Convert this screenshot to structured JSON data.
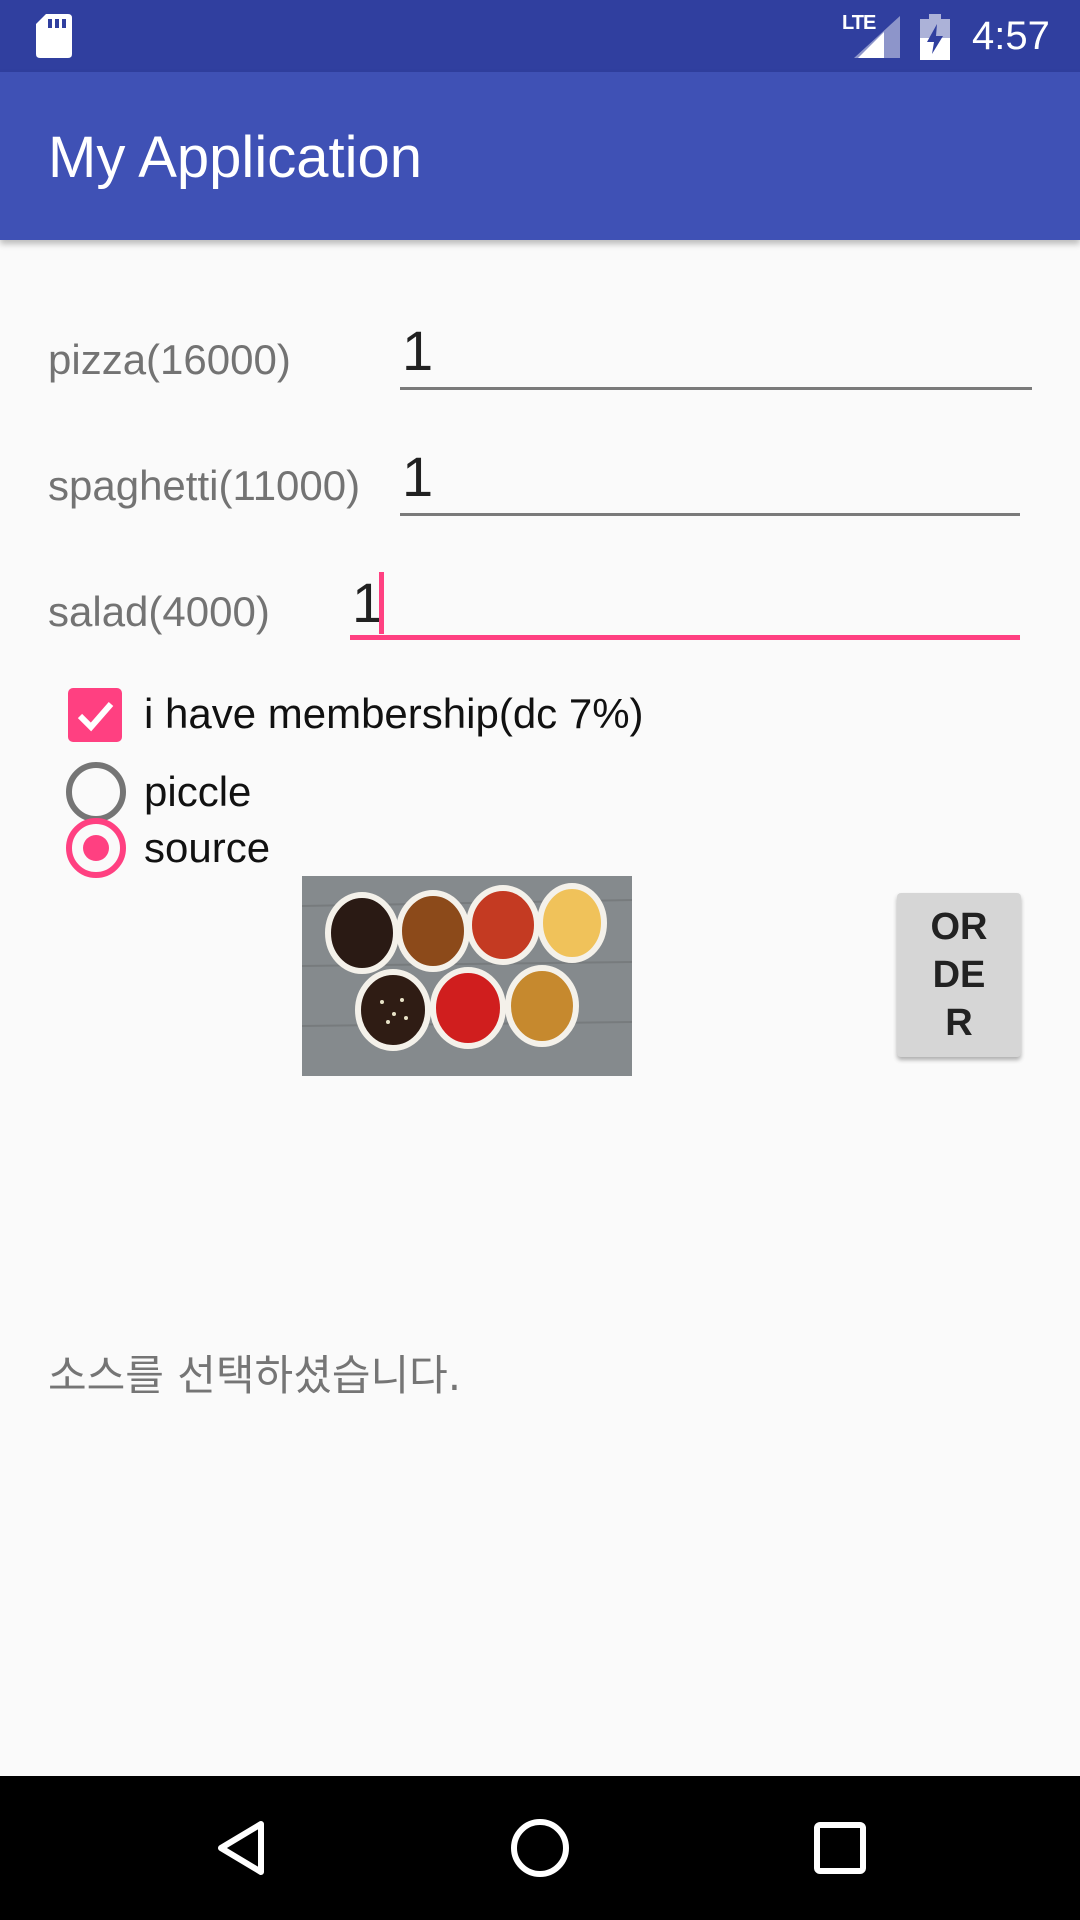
{
  "status_bar": {
    "network_label": "LTE",
    "clock": "4:57",
    "icons": [
      "sd-card-icon",
      "signal-icon",
      "battery-charging-icon"
    ]
  },
  "app_bar": {
    "title": "My Application"
  },
  "form": {
    "pizza": {
      "label": "pizza(16000)",
      "value": "1"
    },
    "spaghetti": {
      "label": "spaghetti(11000)",
      "value": "1"
    },
    "salad": {
      "label": "salad(4000)",
      "value": "1"
    },
    "membership": {
      "label": "i have membership(dc 7%)",
      "checked": true
    },
    "options": [
      {
        "label": "piccle",
        "selected": false
      },
      {
        "label": "source",
        "selected": true
      }
    ]
  },
  "order_button": {
    "lines": [
      "OR",
      "DE",
      "R"
    ]
  },
  "result_message": "소스를 선택하셨습니다.",
  "colors": {
    "status_bar": "#303f9f",
    "app_bar": "#3f51b5",
    "accent": "#ff4081",
    "background": "#fafafa"
  },
  "nav_bar": {
    "icons": [
      "back-icon",
      "home-icon",
      "recents-icon"
    ]
  }
}
